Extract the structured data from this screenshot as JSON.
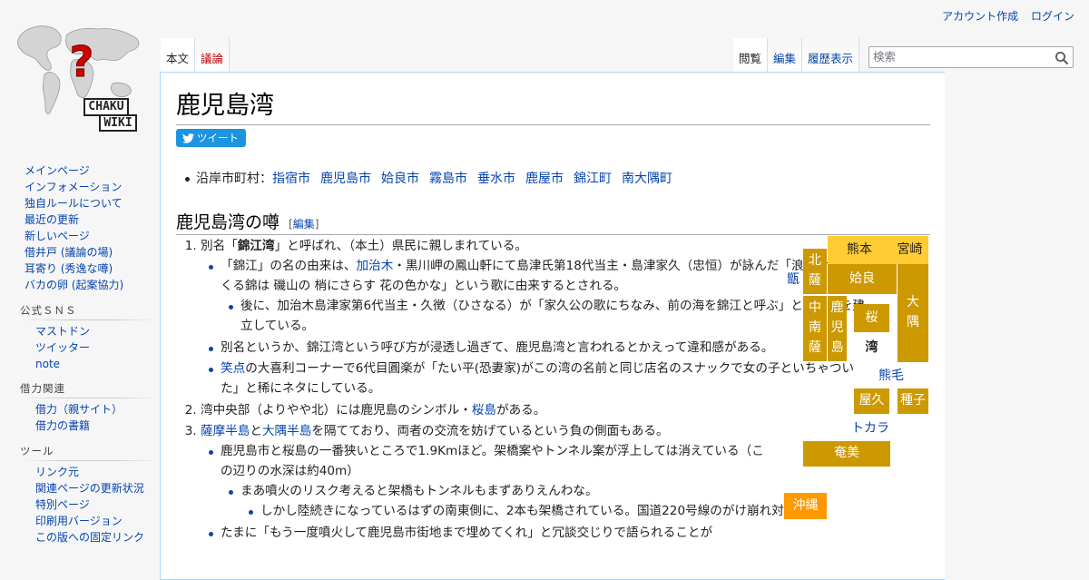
{
  "personal": {
    "create_account": "アカウント作成",
    "login": "ログイン"
  },
  "logo": {
    "line1": "CHAKU",
    "line2": "WIKI"
  },
  "sidebar": {
    "nav": [
      "メインページ",
      "インフォメーション",
      "独自ルールについて",
      "最近の更新",
      "新しいページ",
      "借井戸 (議論の場)",
      "耳寄り (秀逸な噂)",
      "バカの卵 (起案協力)"
    ],
    "sns": {
      "heading": "公式ＳＮＳ",
      "items": [
        "マストドン",
        "ツイッター",
        "note"
      ]
    },
    "related": {
      "heading": "借力関連",
      "items": [
        "借力（親サイト）",
        "借力の書籍"
      ]
    },
    "tools": {
      "heading": "ツール",
      "items": [
        "リンク元",
        "関連ページの更新状況",
        "特別ページ",
        "印刷用バージョン",
        "この版への固定リンク"
      ]
    }
  },
  "tabs": {
    "article": "本文",
    "talk": "議論",
    "view": "閲覧",
    "edit": "編集",
    "history": "履歴表示"
  },
  "search": {
    "placeholder": "検索"
  },
  "page": {
    "title": "鹿児島湾",
    "tweet": "ツイート",
    "towns_label": "沿岸市町村：",
    "towns": [
      "指宿市",
      "鹿児島市",
      "姶良市",
      "霧島市",
      "垂水市",
      "鹿屋市",
      "錦江町",
      "南大隅町"
    ],
    "section": {
      "title": "鹿児島湾の噂",
      "edit_open": "[",
      "edit": "編集",
      "edit_close": "]"
    }
  },
  "content": {
    "i1": {
      "a": "別名「",
      "b": "錦江湾",
      "c": "」と呼ばれ、（本土）県民に親しまれている。"
    },
    "i1_1": {
      "a": "「錦江」の名の由来は、",
      "link": "加治木",
      "b": "・黒川岬の鳳山軒にて島津氏第18代当主・島津家久（忠恒）が詠んだ「浪のおり かくる錦は 磯山の 梢にさらす 花の色かな」という歌に由来するとされる。"
    },
    "i1_1_1": "後に、加治木島津家第6代当主・久徴（ひさなる）が「家久公の歌にちなみ、前の海を錦江と呼ぶ」という碑を建立している。",
    "i1_2": "別名というか、錦江湾という呼び方が浸透し過ぎて、鹿児島湾と言われるとかえって違和感がある。",
    "i1_3": {
      "link": "笑点",
      "a": "の大喜利コーナーで6代目圓楽が「たい平(恐妻家)がこの湾の名前と同じ店名のスナックで女の子といちゃついた」と稀にネタにしている。"
    },
    "i2": {
      "a": "湾中央部（よりやや北）には鹿児島のシンボル・",
      "link": "桜島",
      "b": "がある。"
    },
    "i3": {
      "link1": "薩摩半島",
      "a": "と",
      "link2": "大隅半島",
      "b": "を隔てており、両者の交流を妨げているという負の側面もある。"
    },
    "i3_1": "鹿児島市と桜島の一番狭いところで1.9Kmほど。架橋案やトンネル案が浮上しては消えている（この辺りの水深は約40m）",
    "i3_1_1": "まあ噴火のリスク考えると架橋もトンネルもまずありえんわな。",
    "i3_1_1_1": "しかし陸続きになっているはずの南東側に、2本も架橋されている。国道220号線のがけ崩れ対策で。",
    "i3_2": "たまに「もう一度噴火して鹿児島市街地まで埋めてくれ」と冗談交じりで語られることが"
  },
  "map": {
    "kumamoto": "熊本",
    "miyazaki": "宮崎",
    "koshiki": "甑",
    "hokusatsu": "北\n薩",
    "aira": "姶良",
    "osumi": "大\n隅",
    "chunansatsu": "中\n南\n薩",
    "kagoshima": "鹿\n児\n島",
    "sakurajima": "桜",
    "wan": "湾",
    "kumage": "熊毛",
    "yakushima": "屋久",
    "tanegashima": "種子",
    "tokara": "トカラ",
    "amami": "奄美",
    "okinawa": "沖縄"
  },
  "colors": {
    "region": "#cc9900",
    "neighbor": "#ffcc33",
    "okinawa": "#ff9900",
    "link": "#0645ad",
    "talk": "#ba0000"
  },
  "icons": {
    "search": "search-icon",
    "twitter": "twitter-bird-icon"
  }
}
